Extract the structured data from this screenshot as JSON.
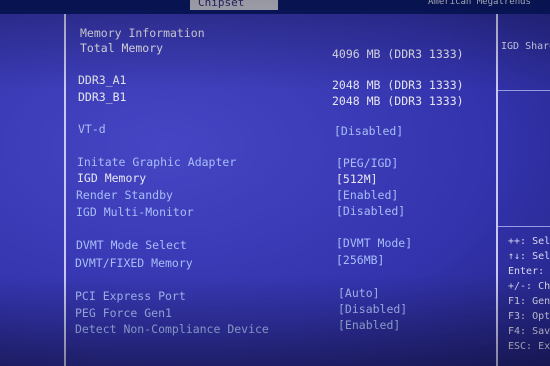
{
  "header": {
    "tab_chipset": "Chipset",
    "vendor": "American Megatrends"
  },
  "info": {
    "memory_information": "Memory Information",
    "total_memory_label": "Total Memory",
    "total_memory_value": "4096 MB (DDR3 1333)",
    "ddr3_a1_label": "DDR3_A1",
    "ddr3_a1_value": "2048 MB (DDR3 1333)",
    "ddr3_b1_label": "DDR3_B1",
    "ddr3_b1_value": "2048 MB (DDR3 1333)"
  },
  "settings": {
    "vtd_label": "VT-d",
    "vtd_value": "[Disabled]",
    "init_graphic_label": "Initate Graphic Adapter",
    "init_graphic_value": "[PEG/IGD]",
    "igd_memory_label": "IGD Memory",
    "igd_memory_value": "[512M]",
    "render_standby_label": "Render Standby",
    "render_standby_value": "[Enabled]",
    "igd_multimonitor_label": "IGD Multi-Monitor",
    "igd_multimonitor_value": "[Disabled]",
    "dvmt_mode_label": "DVMT Mode Select",
    "dvmt_mode_value": "[DVMT Mode]",
    "dvmt_fixed_label": "DVMT/FIXED Memory",
    "dvmt_fixed_value": "[256MB]",
    "pci_express_label": "PCI Express Port",
    "pci_express_value": "[Auto]",
    "peg_force_label": "PEG Force Gen1",
    "peg_force_value": "[Disabled]",
    "detect_noncompliance_label": "Detect Non-Compliance Device",
    "detect_noncompliance_value": "[Enabled]"
  },
  "help": {
    "description": "IGD Share",
    "keys": [
      "++: Sel",
      "↑↓: Sel",
      "Enter:",
      "+/-: Ch",
      "F1: Gen",
      "F3: Opt",
      "F4: Sav",
      "ESC: Ex"
    ]
  }
}
